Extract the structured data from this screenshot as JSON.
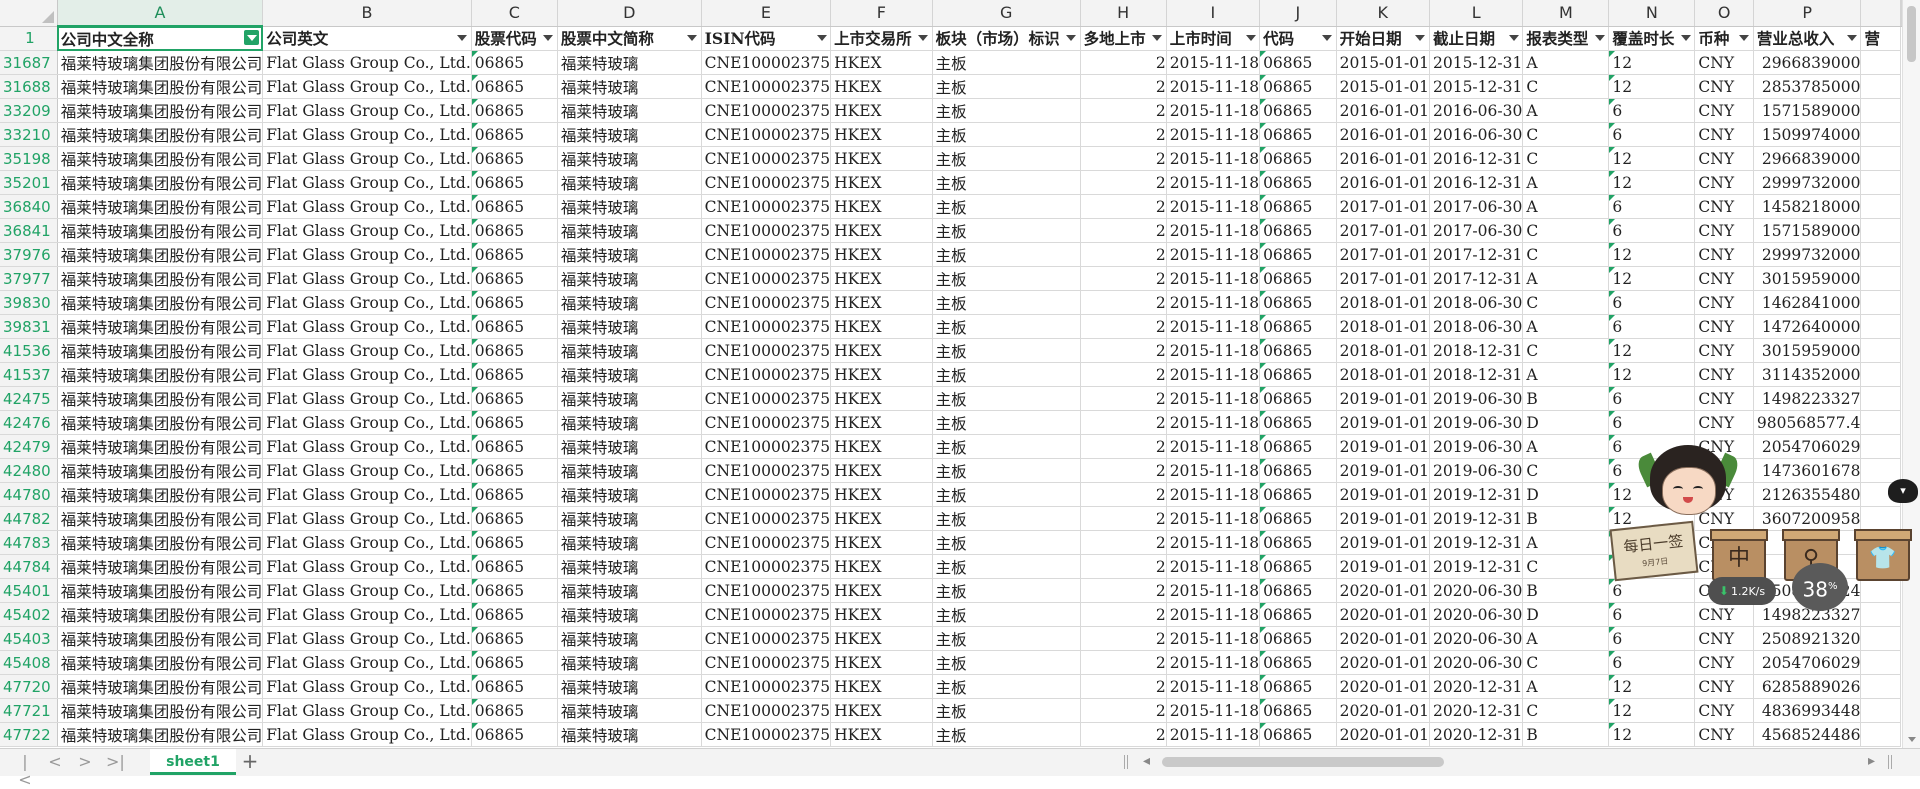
{
  "sheet": {
    "column_letters": [
      "A",
      "B",
      "C",
      "D",
      "E",
      "F",
      "G",
      "H",
      "I",
      "J",
      "K",
      "L",
      "M",
      "N",
      "O",
      "P"
    ],
    "header_row_number": "1",
    "headers": [
      "公司中文全称",
      "公司英文",
      "股票代码",
      "股票中文简称",
      "ISIN代码",
      "上市交易所",
      "板块（市场）标识",
      "多地上市",
      "上市时间",
      "代码",
      "开始日期",
      "截止日期",
      "报表类型",
      "覆盖时长",
      "币种",
      "营业总收入"
    ],
    "truncated_header_tail": "营",
    "rows": [
      {
        "n": "31687",
        "start": "2015-01-01",
        "end": "2015-12-31",
        "type": "A",
        "cov": "12",
        "rev": "2966839000"
      },
      {
        "n": "31688",
        "start": "2015-01-01",
        "end": "2015-12-31",
        "type": "C",
        "cov": "12",
        "rev": "2853785000"
      },
      {
        "n": "33209",
        "start": "2016-01-01",
        "end": "2016-06-30",
        "type": "A",
        "cov": "6",
        "rev": "1571589000"
      },
      {
        "n": "33210",
        "start": "2016-01-01",
        "end": "2016-06-30",
        "type": "C",
        "cov": "6",
        "rev": "1509974000"
      },
      {
        "n": "35198",
        "start": "2016-01-01",
        "end": "2016-12-31",
        "type": "C",
        "cov": "12",
        "rev": "2966839000"
      },
      {
        "n": "35201",
        "start": "2016-01-01",
        "end": "2016-12-31",
        "type": "A",
        "cov": "12",
        "rev": "2999732000"
      },
      {
        "n": "36840",
        "start": "2017-01-01",
        "end": "2017-06-30",
        "type": "A",
        "cov": "6",
        "rev": "1458218000"
      },
      {
        "n": "36841",
        "start": "2017-01-01",
        "end": "2017-06-30",
        "type": "C",
        "cov": "6",
        "rev": "1571589000"
      },
      {
        "n": "37976",
        "start": "2017-01-01",
        "end": "2017-12-31",
        "type": "C",
        "cov": "12",
        "rev": "2999732000"
      },
      {
        "n": "37977",
        "start": "2017-01-01",
        "end": "2017-12-31",
        "type": "A",
        "cov": "12",
        "rev": "3015959000"
      },
      {
        "n": "39830",
        "start": "2018-01-01",
        "end": "2018-06-30",
        "type": "C",
        "cov": "6",
        "rev": "1462841000"
      },
      {
        "n": "39831",
        "start": "2018-01-01",
        "end": "2018-06-30",
        "type": "A",
        "cov": "6",
        "rev": "1472640000"
      },
      {
        "n": "41536",
        "start": "2018-01-01",
        "end": "2018-12-31",
        "type": "C",
        "cov": "12",
        "rev": "3015959000"
      },
      {
        "n": "41537",
        "start": "2018-01-01",
        "end": "2018-12-31",
        "type": "A",
        "cov": "12",
        "rev": "3114352000"
      },
      {
        "n": "42475",
        "start": "2019-01-01",
        "end": "2019-06-30",
        "type": "B",
        "cov": "6",
        "rev": "1498223327"
      },
      {
        "n": "42476",
        "start": "2019-01-01",
        "end": "2019-06-30",
        "type": "D",
        "cov": "6",
        "rev": "980568577.4"
      },
      {
        "n": "42479",
        "start": "2019-01-01",
        "end": "2019-06-30",
        "type": "A",
        "cov": "6",
        "rev": "2054706029"
      },
      {
        "n": "42480",
        "start": "2019-01-01",
        "end": "2019-06-30",
        "type": "C",
        "cov": "6",
        "rev": "1473601678"
      },
      {
        "n": "44780",
        "start": "2019-01-01",
        "end": "2019-12-31",
        "type": "D",
        "cov": "12",
        "rev": "2126355480"
      },
      {
        "n": "44782",
        "start": "2019-01-01",
        "end": "2019-12-31",
        "type": "B",
        "cov": "12",
        "rev": "3607200958"
      },
      {
        "n": "44783",
        "start": "2019-01-01",
        "end": "2019-12-31",
        "type": "A",
        "cov": "12",
        "rev": ""
      },
      {
        "n": "44784",
        "start": "2019-01-01",
        "end": "2019-12-31",
        "type": "C",
        "cov": "12",
        "rev": ""
      },
      {
        "n": "45401",
        "start": "2020-01-01",
        "end": "2020-06-30",
        "type": "B",
        "cov": "6",
        "rev": "2508921924"
      },
      {
        "n": "45402",
        "start": "2020-01-01",
        "end": "2020-06-30",
        "type": "D",
        "cov": "6",
        "rev": "1498223327"
      },
      {
        "n": "45403",
        "start": "2020-01-01",
        "end": "2020-06-30",
        "type": "A",
        "cov": "6",
        "rev": "2508921320"
      },
      {
        "n": "45408",
        "start": "2020-01-01",
        "end": "2020-06-30",
        "type": "C",
        "cov": "6",
        "rev": "2054706029"
      },
      {
        "n": "47720",
        "start": "2020-01-01",
        "end": "2020-12-31",
        "type": "A",
        "cov": "12",
        "rev": "6285889026"
      },
      {
        "n": "47721",
        "start": "2020-01-01",
        "end": "2020-12-31",
        "type": "C",
        "cov": "12",
        "rev": "4836993448"
      },
      {
        "n": "47722",
        "start": "2020-01-01",
        "end": "2020-12-31",
        "type": "B",
        "cov": "12",
        "rev": "4568524486"
      }
    ],
    "constant_values": {
      "company_cn": "福莱特玻璃集团股份有限公司",
      "company_en": "Flat Glass Group Co., Ltd.",
      "stock_code": "06865",
      "short_name": "福莱特玻璃",
      "isin": "CNE100002375",
      "exchange": "HKEX",
      "board": "主板",
      "multi_listing": "2",
      "listing_date": "2015-11-18",
      "code": "06865",
      "currency": "CNY"
    }
  },
  "bottom_bar": {
    "sheet_tab": "sheet1",
    "nav_first": "|<",
    "nav_prev": "<",
    "nav_next": ">",
    "nav_last": ">|",
    "add_sheet": "+"
  },
  "widget": {
    "sign_text": "每日一签",
    "sign_sub": "9月7日",
    "box1": "中",
    "speed": "1.2K/s",
    "percent": "38",
    "percent_unit": "%"
  },
  "colors": {
    "accent": "#21a366",
    "header_bg": "#f3f3f3",
    "grid_line": "#d9d9d9"
  },
  "icons": [
    "filter-dropdown-icon",
    "filter-active-icon",
    "add-sheet-icon",
    "download-arrow-icon"
  ]
}
